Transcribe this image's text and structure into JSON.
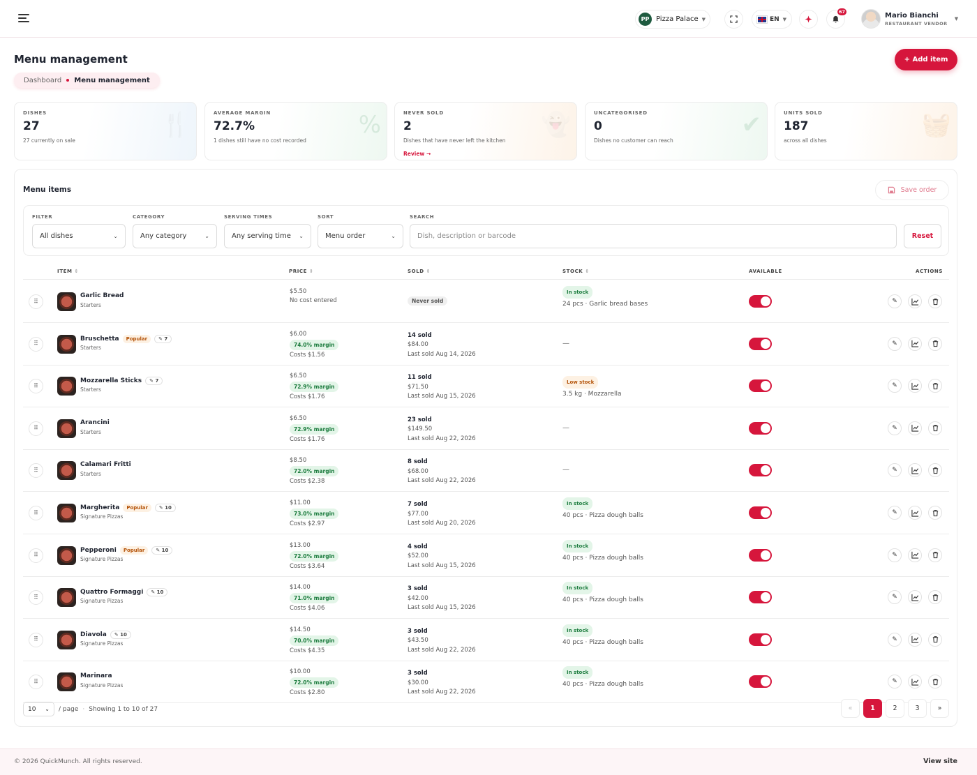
{
  "header": {
    "vendor_initials": "PP",
    "vendor_name": "Pizza Palace",
    "language": "EN",
    "notifications_count": "67",
    "user_name": "Mario Bianchi",
    "user_role": "RESTAURANT VENDOR"
  },
  "page": {
    "title": "Menu management",
    "breadcrumb_root": "Dashboard",
    "breadcrumb_current": "Menu management",
    "add_item_label": "+ Add item"
  },
  "stats": [
    {
      "label": "DISHES",
      "value": "27",
      "sub": "27 currently on sale",
      "icon": "utensils-icon"
    },
    {
      "label": "AVERAGE MARGIN",
      "value": "72.7%",
      "sub": "1 dishes still have no cost recorded",
      "icon": "percent-icon"
    },
    {
      "label": "NEVER SOLD",
      "value": "2",
      "sub": "Dishes that have never left the kitchen",
      "link": "Review →",
      "icon": "ghost-icon"
    },
    {
      "label": "UNCATEGORISED",
      "value": "0",
      "sub": "Dishes no customer can reach",
      "icon": "check-circle-icon"
    },
    {
      "label": "UNITS SOLD",
      "value": "187",
      "sub": "across all dishes",
      "icon": "basket-icon"
    }
  ],
  "menu": {
    "title": "Menu items",
    "save_order_label": "Save order",
    "filters": {
      "filter_label": "FILTER",
      "filter_value": "All dishes",
      "category_label": "CATEGORY",
      "category_value": "Any category",
      "serving_label": "SERVING TIMES",
      "serving_value": "Any serving time",
      "sort_label": "SORT",
      "sort_value": "Menu order",
      "search_label": "SEARCH",
      "search_placeholder": "Dish, description or barcode",
      "reset_label": "Reset"
    },
    "columns": {
      "item": "ITEM",
      "price": "PRICE",
      "sold": "SOLD",
      "stock": "STOCK",
      "available": "AVAILABLE",
      "actions": "ACTIONS"
    },
    "items": [
      {
        "name": "Garlic Bread",
        "category": "Starters",
        "popular": "",
        "tag": "",
        "price": "$5.50",
        "margin": "",
        "cost": "No cost entered",
        "sold": "",
        "revenue": "",
        "last_sold": "",
        "never_sold": "Never sold",
        "stock_badge": "In stock",
        "stock_type": "ok",
        "stock_text": "24 pcs · Garlic bread bases"
      },
      {
        "name": "Bruschetta",
        "category": "Starters",
        "popular": "Popular",
        "tag": "7",
        "price": "$6.00",
        "margin": "74.0% margin",
        "cost": "Costs $1.56",
        "sold": "14 sold",
        "revenue": "$84.00",
        "last_sold": "Last sold Aug 14, 2026",
        "never_sold": "",
        "stock_badge": "",
        "stock_type": "",
        "stock_text": "—"
      },
      {
        "name": "Mozzarella Sticks",
        "category": "Starters",
        "popular": "",
        "tag": "7",
        "price": "$6.50",
        "margin": "72.9% margin",
        "cost": "Costs $1.76",
        "sold": "11 sold",
        "revenue": "$71.50",
        "last_sold": "Last sold Aug 15, 2026",
        "never_sold": "",
        "stock_badge": "Low stock",
        "stock_type": "low",
        "stock_text": "3.5 kg · Mozzarella"
      },
      {
        "name": "Arancini",
        "category": "Starters",
        "popular": "",
        "tag": "",
        "price": "$6.50",
        "margin": "72.9% margin",
        "cost": "Costs $1.76",
        "sold": "23 sold",
        "revenue": "$149.50",
        "last_sold": "Last sold Aug 22, 2026",
        "never_sold": "",
        "stock_badge": "",
        "stock_type": "",
        "stock_text": "—"
      },
      {
        "name": "Calamari Fritti",
        "category": "Starters",
        "popular": "",
        "tag": "",
        "price": "$8.50",
        "margin": "72.0% margin",
        "cost": "Costs $2.38",
        "sold": "8 sold",
        "revenue": "$68.00",
        "last_sold": "Last sold Aug 22, 2026",
        "never_sold": "",
        "stock_badge": "",
        "stock_type": "",
        "stock_text": "—"
      },
      {
        "name": "Margherita",
        "category": "Signature Pizzas",
        "popular": "Popular",
        "tag": "10",
        "price": "$11.00",
        "margin": "73.0% margin",
        "cost": "Costs $2.97",
        "sold": "7 sold",
        "revenue": "$77.00",
        "last_sold": "Last sold Aug 20, 2026",
        "never_sold": "",
        "stock_badge": "In stock",
        "stock_type": "ok",
        "stock_text": "40 pcs · Pizza dough balls"
      },
      {
        "name": "Pepperoni",
        "category": "Signature Pizzas",
        "popular": "Popular",
        "tag": "10",
        "price": "$13.00",
        "margin": "72.0% margin",
        "cost": "Costs $3.64",
        "sold": "4 sold",
        "revenue": "$52.00",
        "last_sold": "Last sold Aug 15, 2026",
        "never_sold": "",
        "stock_badge": "In stock",
        "stock_type": "ok",
        "stock_text": "40 pcs · Pizza dough balls"
      },
      {
        "name": "Quattro Formaggi",
        "category": "Signature Pizzas",
        "popular": "",
        "tag": "10",
        "price": "$14.00",
        "margin": "71.0% margin",
        "cost": "Costs $4.06",
        "sold": "3 sold",
        "revenue": "$42.00",
        "last_sold": "Last sold Aug 15, 2026",
        "never_sold": "",
        "stock_badge": "In stock",
        "stock_type": "ok",
        "stock_text": "40 pcs · Pizza dough balls"
      },
      {
        "name": "Diavola",
        "category": "Signature Pizzas",
        "popular": "",
        "tag": "10",
        "price": "$14.50",
        "margin": "70.0% margin",
        "cost": "Costs $4.35",
        "sold": "3 sold",
        "revenue": "$43.50",
        "last_sold": "Last sold Aug 22, 2026",
        "never_sold": "",
        "stock_badge": "In stock",
        "stock_type": "ok",
        "stock_text": "40 pcs · Pizza dough balls"
      },
      {
        "name": "Marinara",
        "category": "Signature Pizzas",
        "popular": "",
        "tag": "",
        "price": "$10.00",
        "margin": "72.0% margin",
        "cost": "Costs $2.80",
        "sold": "3 sold",
        "revenue": "$30.00",
        "last_sold": "Last sold Aug 22, 2026",
        "never_sold": "",
        "stock_badge": "In stock",
        "stock_type": "ok",
        "stock_text": "40 pcs · Pizza dough balls"
      }
    ],
    "pagination": {
      "per_page": "10",
      "per_page_label": "/ page",
      "separator": "·",
      "showing": "Showing 1 to 10 of 27",
      "prev": "«",
      "pages": [
        "1",
        "2",
        "3"
      ],
      "next": "»",
      "current": "1"
    }
  },
  "footer": {
    "copyright": "© 2026 QuickMunch. All rights reserved.",
    "view_site": "View site"
  },
  "colors": {
    "accent": "#d6163c",
    "success": "#1c7c3e",
    "warning": "#b45309"
  }
}
